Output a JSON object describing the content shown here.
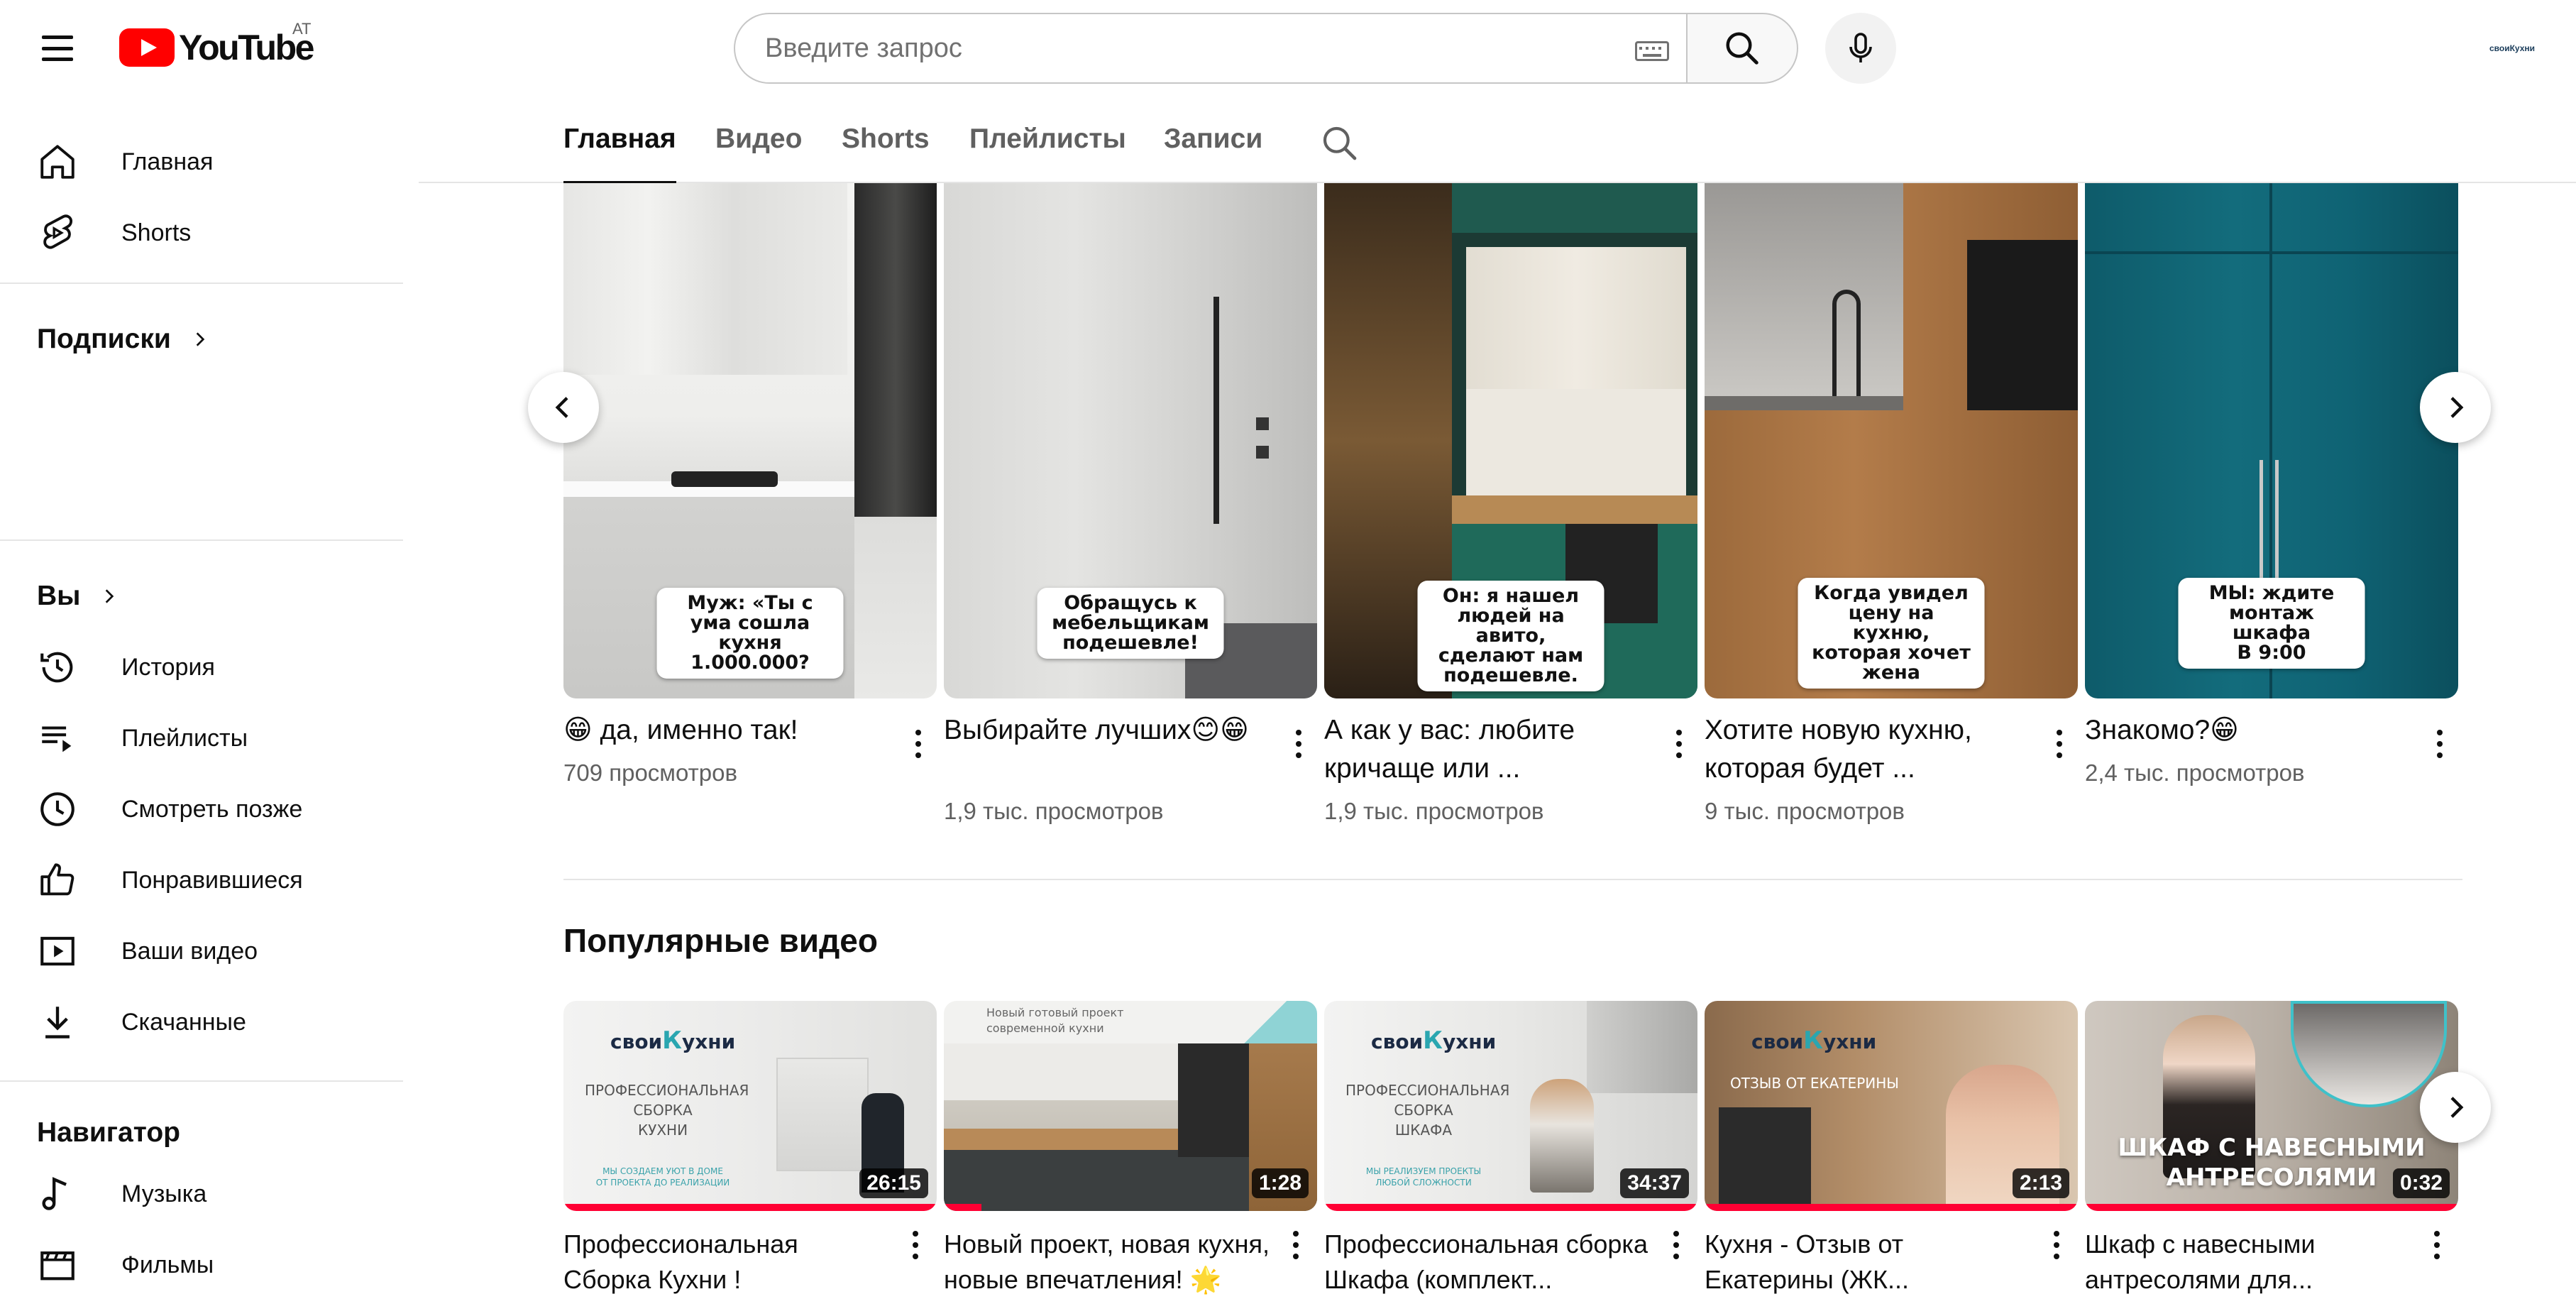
{
  "app": {
    "logo_text": "YouTube",
    "region": "AT"
  },
  "search": {
    "placeholder": "Введите запрос"
  },
  "channel_avatar": {
    "text": "своиКухни"
  },
  "sidebar": {
    "top": [
      {
        "label": "Главная",
        "icon": "home-icon"
      },
      {
        "label": "Shorts",
        "icon": "shorts-icon"
      }
    ],
    "subscriptions_title": "Подписки",
    "you_title": "Вы",
    "you_items": [
      {
        "label": "История",
        "icon": "history-icon"
      },
      {
        "label": "Плейлисты",
        "icon": "playlist-icon"
      },
      {
        "label": "Смотреть позже",
        "icon": "clock-icon"
      },
      {
        "label": "Понравившиеся",
        "icon": "thumbs-up-icon"
      },
      {
        "label": "Ваши видео",
        "icon": "your-videos-icon"
      },
      {
        "label": "Скачанные",
        "icon": "download-icon"
      }
    ],
    "navigator_title": "Навигатор",
    "navigator_items": [
      {
        "label": "Музыка",
        "icon": "music-note-icon"
      },
      {
        "label": "Фильмы",
        "icon": "film-icon"
      }
    ]
  },
  "tabs": [
    "Главная",
    "Видео",
    "Shorts",
    "Плейлисты",
    "Записи"
  ],
  "shorts": [
    {
      "caption": "Муж: «Ты с ума сошла\nкухня 1.000.000?",
      "title": "😁 да, именно так!",
      "views": "709 просмотров"
    },
    {
      "caption": "Обращусь к мебельщикам\nподешевле!",
      "title": "Выбирайте лучших😊😁",
      "views": "1,9 тыс. просмотров"
    },
    {
      "caption": "Он: я нашел людей на авито,\nсделают нам подешевле.",
      "title": "А как у вас: любите кричаще или ...",
      "views": "1,9 тыс. просмотров"
    },
    {
      "caption": "Когда увидел цену на кухню,\nкоторая хочет жена",
      "title": "Хотите новую кухню, которая будет ...",
      "views": "9 тыс. просмотров"
    },
    {
      "caption": "МЫ: ждите монтаж шкафа\nВ 9:00",
      "title": "Знакомо?😁",
      "views": "2,4 тыс. просмотров"
    }
  ],
  "popular": {
    "title": "Популярные видео",
    "videos": [
      {
        "title": "Профессиональная Сборка Кухни !",
        "duration": "26:15",
        "progress": 1.0,
        "brand": "свои",
        "brand_k": "К",
        "brand_rest": "ухни",
        "thumb_lines": "ПРОФЕССИОНАЛЬНАЯ\nСБОРКА\nКУХНИ",
        "thumb_small": "МЫ СОЗДАЕМ УЮТ В ДОМЕ\nОТ ПРОЕКТА ДО РЕАЛИЗАЦИИ"
      },
      {
        "title": "Новый проект, новая кухня, новые впечатления! 🌟",
        "duration": "1:28",
        "progress": 0.1,
        "thumb_lines": "Новый готовый проект\nсовременной кухни"
      },
      {
        "title": "Профессиональная сборка Шкафа (комплект...",
        "duration": "34:37",
        "progress": 1.0,
        "brand": "свои",
        "brand_k": "К",
        "brand_rest": "ухни",
        "thumb_lines": "ПРОФЕССИОНАЛЬНАЯ\nСБОРКА\nШКАФА",
        "thumb_small": "МЫ РЕАЛИЗУЕМ ПРОЕКТЫ\nЛЮБОЙ СЛОЖНОСТИ"
      },
      {
        "title": "Кухня - Отзыв от Екатерины (ЖК...",
        "duration": "2:13",
        "progress": 1.0,
        "brand": "свои",
        "brand_k": "К",
        "brand_rest": "ухни",
        "thumb_lines": "ОТЗЫВ ОТ ЕКАТЕРИНЫ"
      },
      {
        "title": "Шкаф с навесными антресолями для...",
        "duration": "0:32",
        "progress": 1.0,
        "thumb_lines": "ШКАФ С НАВЕСНЫМИ\nАНТРЕСОЛЯМИ"
      }
    ]
  },
  "colors": {
    "accent": "#ff0000",
    "progress": "#ff0033",
    "text": "#0f0f0f",
    "secondary": "#606060"
  }
}
